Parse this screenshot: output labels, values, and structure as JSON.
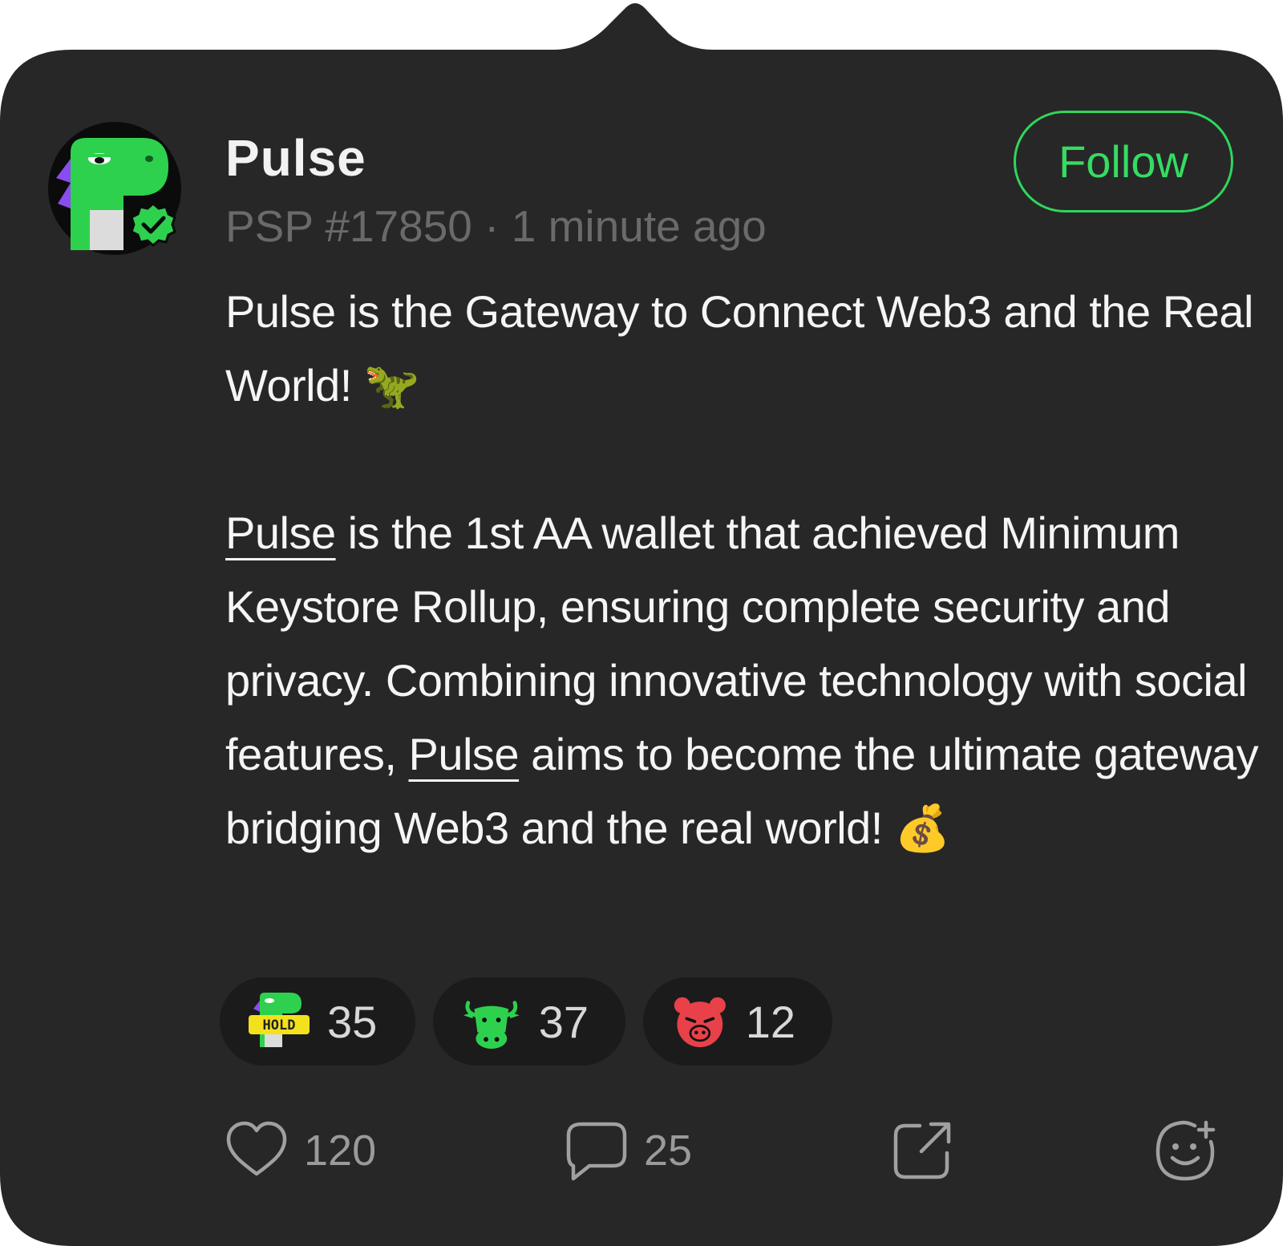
{
  "author": {
    "name": "Pulse",
    "meta": "PSP #17850 · 1 minute ago"
  },
  "follow_label": "Follow",
  "post": {
    "p1": "Pulse is the Gateway to Connect Web3 and the Real World! 🦖",
    "p2_mention": "Pulse",
    "p2_a": " is the 1st AA wallet that achieved Minimum Keystore Rollup, ensuring complete security and privacy. Combining innovative technology with social features, ",
    "p2_mention2": "Pulse",
    "p2_b": " aims to become the ultimate gateway bridging Web3 and the real world! 💰"
  },
  "reactions": [
    {
      "name": "hold",
      "count": "35",
      "icon_text": "HOLD"
    },
    {
      "name": "bull",
      "count": "37"
    },
    {
      "name": "bear",
      "count": "12"
    }
  ],
  "actions": {
    "likes": "120",
    "comments": "25"
  },
  "colors": {
    "card": "#272727",
    "accent": "#2fd65d",
    "muted": "#6a6a6a"
  }
}
